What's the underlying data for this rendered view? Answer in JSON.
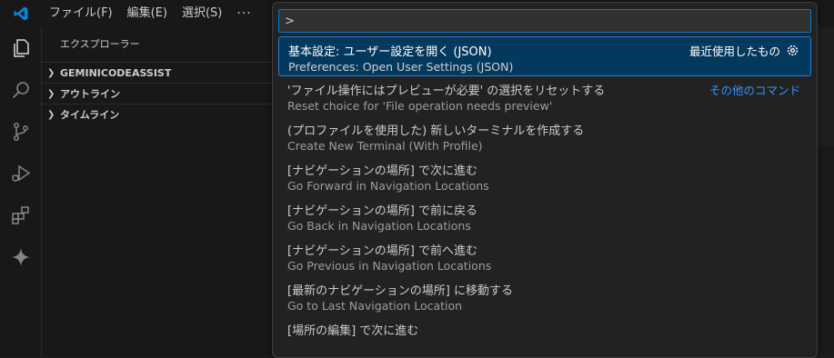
{
  "titlebar": {
    "menus": [
      "ファイル(F)",
      "編集(E)",
      "選択(S)"
    ],
    "more": "···"
  },
  "activitybar": {
    "icons": [
      "explorer-icon",
      "search-icon",
      "source-control-icon",
      "run-debug-icon",
      "extensions-icon",
      "gemini-sparkle-icon"
    ]
  },
  "sidebar": {
    "title": "エクスプローラー",
    "sections": [
      "GEMINICODEASSIST",
      "アウトライン",
      "タイムライン"
    ]
  },
  "quickpick": {
    "input_value": ">",
    "items": [
      {
        "label": "基本設定: ユーザー設定を開く (JSON)",
        "detail": "Preferences: Open User Settings (JSON)",
        "right": "最近使用したもの"
      },
      {
        "label": "'ファイル操作にはプレビューが必要' の選択をリセットする",
        "detail": "Reset choice for 'File operation needs preview'",
        "right": "その他のコマンド"
      },
      {
        "label": "(プロファイルを使用した) 新しいターミナルを作成する",
        "detail": "Create New Terminal (With Profile)",
        "right": ""
      },
      {
        "label": "[ナビゲーションの場所] で次に進む",
        "detail": "Go Forward in Navigation Locations",
        "right": ""
      },
      {
        "label": "[ナビゲーションの場所] で前に戻る",
        "detail": "Go Back in Navigation Locations",
        "right": ""
      },
      {
        "label": "[ナビゲーションの場所] で前へ進む",
        "detail": "Go Previous in Navigation Locations",
        "right": ""
      },
      {
        "label": "[最新のナビゲーションの場所] に移動する",
        "detail": "Go to Last Navigation Location",
        "right": ""
      },
      {
        "label": "[場所の編集] で次に進む",
        "detail": "",
        "right": ""
      }
    ]
  },
  "colors": {
    "accent": "#0078d4",
    "selection": "#04395e",
    "link": "#3794ff"
  }
}
